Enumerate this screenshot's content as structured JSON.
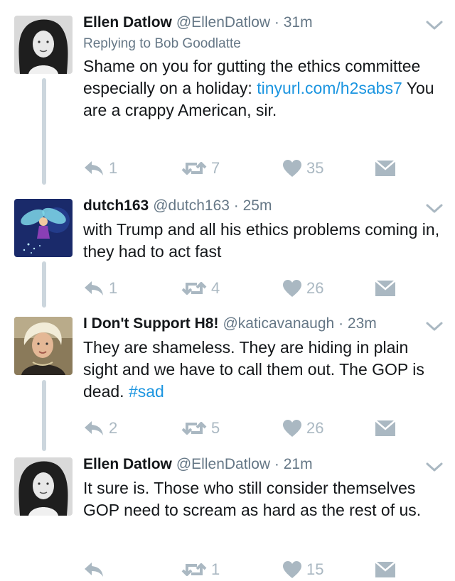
{
  "tweets": [
    {
      "name": "Ellen Datlow",
      "handle": "@EllenDatlow",
      "dot": " · ",
      "time": "31m",
      "reply_to": "Replying to Bob Goodlatte",
      "text_before": "Shame on you for gutting the ethics committee especially on a holiday: ",
      "link": "tinyurl.com/h2sabs7",
      "text_after": " You are a crappy American, sir.",
      "replies": "1",
      "retweets": "7",
      "likes": "35",
      "avatar_icon": "woman-curly-hair-bw-avatar"
    },
    {
      "name": "dutch163",
      "handle": "@dutch163",
      "dot": " · ",
      "time": "25m",
      "text": "with Trump and all his ethics problems coming in, they had to act fast",
      "replies": "1",
      "retweets": "4",
      "likes": "26",
      "avatar_icon": "fairy-avatar"
    },
    {
      "name": "I Don't Support H8!",
      "handle": "@katicavanaugh",
      "dot": " · ",
      "time": "23m",
      "text": "They are shameless. They are hiding in plain sight and we have to call them out. The GOP is dead. ",
      "hashtag": "#sad",
      "replies": "2",
      "retweets": "5",
      "likes": "26",
      "avatar_icon": "blonde-woman-avatar"
    },
    {
      "name": "Ellen Datlow",
      "handle": "@EllenDatlow",
      "dot": " · ",
      "time": "21m",
      "text": "It sure is. Those who still consider themselves GOP need to scream as hard as the rest of us.",
      "replies": "",
      "retweets": "1",
      "likes": "15",
      "avatar_icon": "woman-curly-hair-bw-avatar"
    }
  ],
  "colors": {
    "text": "#14171a",
    "secondary": "#657786",
    "link": "#1b95e0",
    "icon": "#aab8c2",
    "thread_line": "#ccd6dd"
  }
}
